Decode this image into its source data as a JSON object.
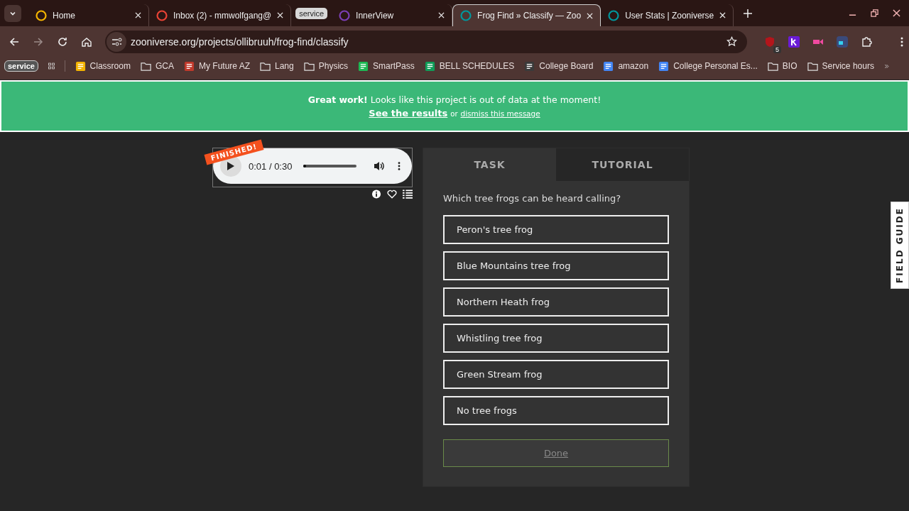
{
  "browser": {
    "tabs": [
      {
        "kind": "tab",
        "title": "Home",
        "color": "#f4b400",
        "selected": false
      },
      {
        "kind": "tab",
        "title": "Inbox (2) - mmwolfgang@",
        "color": "#ea4335",
        "selected": false
      },
      {
        "kind": "group",
        "title": "service"
      },
      {
        "kind": "tab",
        "title": "InnerView",
        "color": "#7b3fb5",
        "selected": false
      },
      {
        "kind": "tab",
        "title": "Frog Find » Classify — Zoo",
        "color": "#00979d",
        "selected": true
      },
      {
        "kind": "tab",
        "title": "User Stats | Zooniverse",
        "color": "#00979d",
        "selected": false
      }
    ],
    "url": "zooniverse.org/projects/ollibruuh/frog-find/classify",
    "extension_badge": "5",
    "bookmarks": [
      {
        "kind": "group",
        "label": "service"
      },
      {
        "kind": "favicon",
        "label": "Classroom",
        "color": "#f4b400"
      },
      {
        "kind": "folder",
        "label": "GCA"
      },
      {
        "kind": "favicon",
        "label": "My Future AZ",
        "color": "#c0392b"
      },
      {
        "kind": "folder",
        "label": "Lang"
      },
      {
        "kind": "folder",
        "label": "Physics"
      },
      {
        "kind": "favicon",
        "label": "SmartPass",
        "color": "#1db954"
      },
      {
        "kind": "favicon",
        "label": "BELL SCHEDULES",
        "color": "#0f9d58"
      },
      {
        "kind": "favicon",
        "label": "College Board",
        "color": "#3a3a3a"
      },
      {
        "kind": "favicon",
        "label": "amazon",
        "color": "#4285f4"
      },
      {
        "kind": "favicon",
        "label": "College Personal Es...",
        "color": "#4285f4"
      },
      {
        "kind": "folder",
        "label": "BIO"
      },
      {
        "kind": "folder",
        "label": "Service hours"
      }
    ]
  },
  "banner": {
    "text": "**Great work!** Looks like this project is out of data at the moment!",
    "link": "See the results",
    "or": "or",
    "dismiss": "dismiss this message"
  },
  "player": {
    "badge": "FINISHED!",
    "time": "0:01 / 0:30",
    "level": 0.05
  },
  "task": {
    "tabs": [
      {
        "label": "TASK",
        "selected": true
      },
      {
        "label": "TUTORIAL",
        "selected": false
      }
    ],
    "question": "Which tree frogs can be heard calling?",
    "choices": [
      {
        "label": "Peron's tree frog",
        "selected": false
      },
      {
        "label": "Blue Mountains tree frog",
        "selected": false
      },
      {
        "label": "Northern Heath frog",
        "selected": false
      },
      {
        "label": "Whistling tree frog",
        "selected": false
      },
      {
        "label": "Green Stream frog",
        "selected": false
      },
      {
        "label": "No tree frogs",
        "selected": false
      }
    ],
    "done": {
      "label": "Done",
      "disabled": true
    }
  },
  "field_guide": "FIELD GUIDE"
}
